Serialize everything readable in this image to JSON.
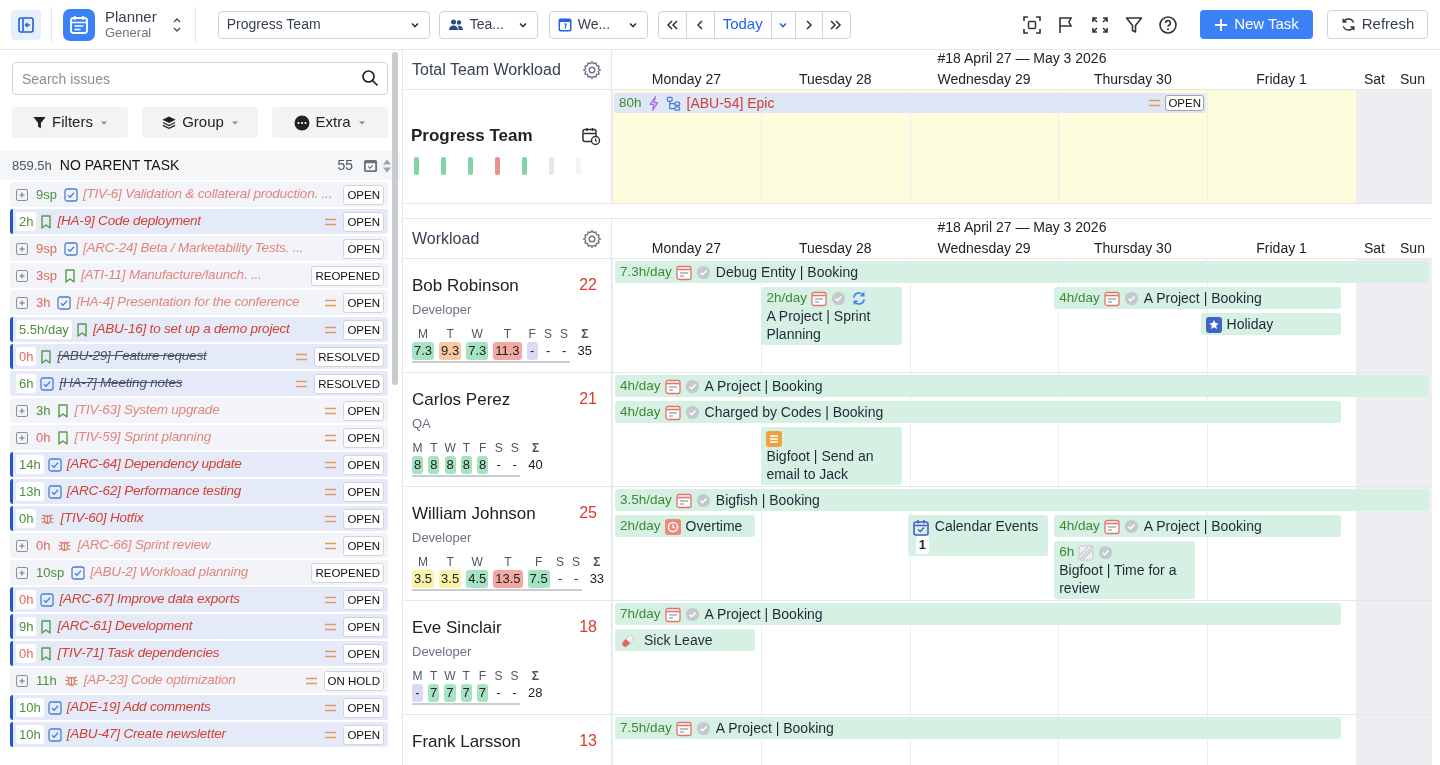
{
  "toolbar": {
    "app_title": "Planner",
    "app_subtitle": "General",
    "team_select": "Progress Team",
    "view_select": "Tea...",
    "period_select": "We...",
    "today": "Today",
    "new_task": "New Task",
    "refresh": "Refresh"
  },
  "sidebar": {
    "search": {
      "placeholder": "Search issues"
    },
    "buttons": [
      "Filters",
      "Group",
      "Extra"
    ],
    "group": {
      "hours": "859.5h",
      "title": "NO PARENT TASK",
      "count": "55"
    },
    "issues": [
      {
        "expandable": true,
        "highlighted": false,
        "estimate": "9sp",
        "overdue": false,
        "kind": "task",
        "title": "[TIV-6] Validation & collateral production. ...",
        "resolved": false,
        "prioritized": false,
        "status": "OPEN"
      },
      {
        "expandable": false,
        "highlighted": true,
        "estimate": "2h",
        "overdue": false,
        "kind": "story",
        "title": "[HA-9] Code deployment",
        "resolved": false,
        "prioritized": true,
        "status": "OPEN"
      },
      {
        "expandable": true,
        "highlighted": false,
        "estimate": "9sp",
        "overdue": true,
        "kind": "task",
        "title": "[ARC-24] Beta / Marketability Tests. ...",
        "resolved": false,
        "prioritized": false,
        "status": "OPEN"
      },
      {
        "expandable": true,
        "highlighted": false,
        "estimate": "3sp",
        "overdue": true,
        "kind": "story",
        "title": "[ATI-11] Manufacture/launch. ...",
        "resolved": false,
        "prioritized": false,
        "status": "REOPENED"
      },
      {
        "expandable": true,
        "highlighted": false,
        "estimate": "3h",
        "overdue": true,
        "kind": "task",
        "title": "[HA-4] Presentation for the conference",
        "resolved": false,
        "prioritized": true,
        "status": "OPEN"
      },
      {
        "expandable": false,
        "highlighted": true,
        "estimate": "5.5h/day",
        "overdue": false,
        "kind": "story",
        "title": "[ABU-16] to set up a demo project",
        "resolved": false,
        "prioritized": true,
        "status": "OPEN"
      },
      {
        "expandable": false,
        "highlighted": true,
        "estimate": "0h",
        "overdue": true,
        "kind": "story",
        "title": "[ABU-29] Feature request",
        "resolved": true,
        "prioritized": true,
        "status": "RESOLVED"
      },
      {
        "expandable": false,
        "highlighted": false,
        "estimate": "6h",
        "overdue": false,
        "kind": "task",
        "title": "[HA-7] Meeting notes",
        "resolved": true,
        "prioritized": true,
        "status": "RESOLVED"
      },
      {
        "expandable": true,
        "highlighted": false,
        "estimate": "3h",
        "overdue": false,
        "kind": "story",
        "title": "[TIV-63] System upgrade",
        "resolved": false,
        "prioritized": true,
        "status": "OPEN"
      },
      {
        "expandable": true,
        "highlighted": false,
        "estimate": "0h",
        "overdue": true,
        "kind": "story",
        "title": "[TIV-59] Sprint planning",
        "resolved": false,
        "prioritized": true,
        "status": "OPEN"
      },
      {
        "expandable": false,
        "highlighted": true,
        "estimate": "14h",
        "overdue": false,
        "kind": "task",
        "title": "[ARC-64] Dependency update",
        "resolved": false,
        "prioritized": true,
        "status": "OPEN"
      },
      {
        "expandable": false,
        "highlighted": true,
        "estimate": "13h",
        "overdue": false,
        "kind": "task",
        "title": "[ARC-62] Performance testing",
        "resolved": false,
        "prioritized": true,
        "status": "OPEN"
      },
      {
        "expandable": false,
        "highlighted": true,
        "estimate": "0h",
        "overdue": false,
        "kind": "bug",
        "title": "[TIV-60] Hotfix",
        "resolved": false,
        "prioritized": true,
        "status": "OPEN"
      },
      {
        "expandable": true,
        "highlighted": false,
        "estimate": "0h",
        "overdue": true,
        "kind": "bug",
        "title": "[ARC-66] Sprint review",
        "resolved": false,
        "prioritized": true,
        "status": "OPEN"
      },
      {
        "expandable": true,
        "highlighted": false,
        "estimate": "10sp",
        "overdue": false,
        "kind": "task",
        "title": "[ABU-2] Workload planning",
        "resolved": false,
        "prioritized": false,
        "status": "REOPENED"
      },
      {
        "expandable": false,
        "highlighted": true,
        "estimate": "0h",
        "overdue": true,
        "kind": "task",
        "title": "[ARC-67] Improve data exports",
        "resolved": false,
        "prioritized": true,
        "status": "OPEN"
      },
      {
        "expandable": false,
        "highlighted": true,
        "estimate": "9h",
        "overdue": false,
        "kind": "story",
        "title": "[ARC-61] Development",
        "resolved": false,
        "prioritized": true,
        "status": "OPEN"
      },
      {
        "expandable": false,
        "highlighted": true,
        "estimate": "0h",
        "overdue": true,
        "kind": "story",
        "title": "[TIV-71] Task dependencies",
        "resolved": false,
        "prioritized": true,
        "status": "OPEN"
      },
      {
        "expandable": true,
        "highlighted": false,
        "estimate": "11h",
        "overdue": false,
        "kind": "bug",
        "title": "[AP-23] Code optimization",
        "resolved": false,
        "prioritized": true,
        "status": "ON HOLD"
      },
      {
        "expandable": false,
        "highlighted": true,
        "estimate": "10h",
        "overdue": false,
        "kind": "task",
        "title": "[ADE-19] Add comments",
        "resolved": false,
        "prioritized": true,
        "status": "OPEN"
      },
      {
        "expandable": false,
        "highlighted": true,
        "estimate": "10h",
        "overdue": false,
        "kind": "task",
        "title": "[ABU-47] Create newsletter",
        "resolved": false,
        "prioritized": true,
        "status": "OPEN"
      }
    ]
  },
  "team_workload": {
    "title": "Total Team Workload",
    "week": "#18 April 27 — May 3 2026",
    "days": [
      {
        "label": "Monday 27",
        "weekend": false
      },
      {
        "label": "Tuesday 28",
        "weekend": false
      },
      {
        "label": "Wednesday 29",
        "weekend": false
      },
      {
        "label": "Thursday 30",
        "weekend": false
      },
      {
        "label": "Friday 1",
        "weekend": false
      },
      {
        "label": "Sat",
        "weekend": true
      },
      {
        "label": "Sun",
        "weekend": true
      }
    ],
    "team": {
      "name": "Progress Team",
      "day_loads": [
        {
          "kind": "good"
        },
        {
          "kind": "good"
        },
        {
          "kind": "good"
        },
        {
          "kind": "over"
        },
        {
          "kind": "good"
        },
        {
          "kind": "off"
        },
        {
          "kind": "none"
        }
      ],
      "epic": {
        "hours": "80h",
        "title": "[ABU-54] Epic",
        "prioritized": true,
        "status": "OPEN"
      }
    }
  },
  "workload": {
    "title": "Workload",
    "week": "#18 April 27 — May 3 2026",
    "days": [
      {
        "label": "Monday 27",
        "weekend": false
      },
      {
        "label": "Tuesday 28",
        "weekend": false
      },
      {
        "label": "Wednesday 29",
        "weekend": false
      },
      {
        "label": "Thursday 30",
        "weekend": false
      },
      {
        "label": "Friday 1",
        "weekend": false
      },
      {
        "label": "Sat",
        "weekend": true
      },
      {
        "label": "Sun",
        "weekend": true
      }
    ],
    "people": [
      {
        "name": "Bob Robinson",
        "role": "Developer",
        "load": "22",
        "sum_label": "Σ",
        "total": "35",
        "stats": [
          {
            "day": "M",
            "value": "7.3",
            "kind": "good"
          },
          {
            "day": "T",
            "value": "9.3",
            "kind": "high"
          },
          {
            "day": "W",
            "value": "7.3",
            "kind": "good"
          },
          {
            "day": "T",
            "value": "11.3",
            "kind": "over"
          },
          {
            "day": "F",
            "value": "-",
            "kind": "absent"
          },
          {
            "day": "S",
            "value": "-",
            "kind": "free"
          },
          {
            "day": "S",
            "value": "-",
            "kind": "free"
          }
        ],
        "events": [
          {
            "hours": "7.3h/day",
            "kind": "booking",
            "title": "Debug Entity | Booking"
          },
          {
            "hours": "2h/day",
            "kind": "recurring",
            "title": "A Project | Sprint Planning"
          },
          {
            "hours": "4h/day",
            "kind": "booking",
            "title": "A Project | Booking"
          },
          {
            "kind": "holiday",
            "title": "Holiday"
          }
        ]
      },
      {
        "name": "Carlos Perez",
        "role": "QA",
        "load": "21",
        "sum_label": "Σ",
        "total": "40",
        "stats": [
          {
            "day": "M",
            "value": "8",
            "kind": "good"
          },
          {
            "day": "T",
            "value": "8",
            "kind": "good"
          },
          {
            "day": "W",
            "value": "8",
            "kind": "good"
          },
          {
            "day": "T",
            "value": "8",
            "kind": "good"
          },
          {
            "day": "F",
            "value": "8",
            "kind": "good"
          },
          {
            "day": "S",
            "value": "-",
            "kind": "free"
          },
          {
            "day": "S",
            "value": "-",
            "kind": "free"
          }
        ],
        "events": [
          {
            "hours": "4h/day",
            "kind": "booking",
            "title": "A Project | Booking"
          },
          {
            "hours": "4h/day",
            "kind": "booking",
            "title": "Charged by Codes | Booking"
          },
          {
            "kind": "list",
            "title": "Bigfoot | Send an email to Jack"
          }
        ]
      },
      {
        "name": "William Johnson",
        "role": "Developer",
        "load": "25",
        "sum_label": "Σ",
        "total": "33",
        "stats": [
          {
            "day": "M",
            "value": "3.5",
            "kind": "low"
          },
          {
            "day": "T",
            "value": "3.5",
            "kind": "low"
          },
          {
            "day": "W",
            "value": "4.5",
            "kind": "good"
          },
          {
            "day": "T",
            "value": "13.5",
            "kind": "over"
          },
          {
            "day": "F",
            "value": "7.5",
            "kind": "good"
          },
          {
            "day": "S",
            "value": "-",
            "kind": "free"
          },
          {
            "day": "S",
            "value": "-",
            "kind": "free"
          }
        ],
        "events": [
          {
            "hours": "3.5h/day",
            "kind": "booking",
            "title": "Bigfish | Booking"
          },
          {
            "hours": "2h/day",
            "kind": "overtime",
            "title": "Overtime"
          },
          {
            "kind": "calendar",
            "title": "Calendar Events",
            "count": "1"
          },
          {
            "hours": "4h/day",
            "kind": "booking",
            "title": "A Project | Booking"
          },
          {
            "hours": "6h",
            "kind": "worklog",
            "title": "Bigfoot | Time for a review"
          }
        ]
      },
      {
        "name": "Eve Sinclair",
        "role": "Developer",
        "load": "18",
        "sum_label": "Σ",
        "total": "28",
        "stats": [
          {
            "day": "M",
            "value": "-",
            "kind": "absent"
          },
          {
            "day": "T",
            "value": "7",
            "kind": "good"
          },
          {
            "day": "W",
            "value": "7",
            "kind": "good"
          },
          {
            "day": "T",
            "value": "7",
            "kind": "good"
          },
          {
            "day": "F",
            "value": "7",
            "kind": "good"
          },
          {
            "day": "S",
            "value": "-",
            "kind": "free"
          },
          {
            "day": "S",
            "value": "-",
            "kind": "free"
          }
        ],
        "events": [
          {
            "hours": "7h/day",
            "kind": "booking",
            "title": "A Project | Booking"
          },
          {
            "kind": "sick",
            "title": "Sick Leave"
          }
        ]
      },
      {
        "name": "Frank Larsson",
        "load": "13",
        "events": [
          {
            "hours": "7.5h/day",
            "kind": "booking",
            "title": "A Project | Booking"
          }
        ]
      }
    ]
  }
}
